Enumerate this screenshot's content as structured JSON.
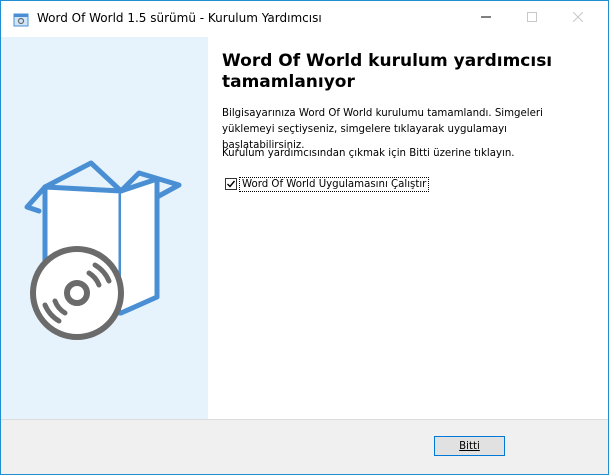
{
  "window": {
    "title": "Word Of World 1.5 sürümü - Kurulum Yardımcısı",
    "controls": [
      "minimize-icon",
      "maximize-icon",
      "close-icon"
    ]
  },
  "main": {
    "heading": "Word Of World kurulum yardımcısı tamamlanıyor",
    "paragraph1": "Bilgisayarınıza Word Of World kurulumu tamamlandı. Simgeleri yüklemeyi seçtiyseniz, simgelere tıklayarak uygulamayı başlatabilirsiniz.",
    "paragraph2": "Kurulum yardımcısından çıkmak için Bitti üzerine tıklayın.",
    "run_checkbox": {
      "label": "Word Of World Uygulamasını Çalıştır",
      "checked": true
    }
  },
  "footer": {
    "finish_label": "Bitti"
  },
  "colors": {
    "sidebar": "#e6f3fd",
    "accent": "#1f8fd1",
    "icon_blue": "#4a8fd4",
    "disc_gray": "#6b6b6b"
  }
}
